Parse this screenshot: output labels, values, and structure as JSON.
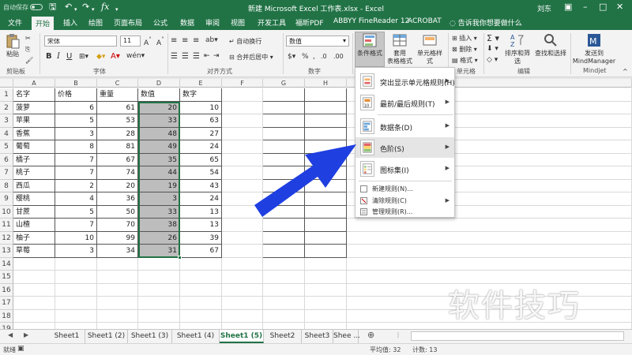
{
  "window": {
    "autosave": "自动保存",
    "title": "新建 Microsoft Excel 工作表.xlsx - Excel",
    "user": "刘东"
  },
  "tabs": [
    "文件",
    "开始",
    "插入",
    "绘图",
    "页面布局",
    "公式",
    "数据",
    "审阅",
    "视图",
    "开发工具",
    "福昕PDF",
    "ABBYY FineReader 12",
    "ACROBAT"
  ],
  "tell_me": "告诉我你想要做什么",
  "ribbon": {
    "paste": "粘贴",
    "font_name": "宋体",
    "font_size": "11",
    "wrap_text": "自动换行",
    "merge_center": "合并后居中",
    "number_format": "数值",
    "cond_format": "条件格式",
    "table_format": "套用\n表格格式",
    "cell_style": "单元格样式",
    "insert": "插入",
    "delete": "删除",
    "format": "格式",
    "sort_filter": "排序和筛选",
    "find_select": "查找和选择",
    "send_to": "发送到\nMindManager",
    "groups": {
      "clipboard": "剪贴板",
      "font": "字体",
      "alignment": "对齐方式",
      "number": "数字",
      "cells": "单元格",
      "editing": "编辑",
      "mindjet": "Mindjet"
    }
  },
  "columns": [
    "A",
    "B",
    "C",
    "D",
    "E",
    "F",
    "G",
    "H"
  ],
  "sheet": {
    "headers": [
      "名字",
      "价格",
      "重量",
      "数值",
      "数字"
    ],
    "rows": [
      [
        "菠萝",
        "6",
        "61",
        "20",
        "10"
      ],
      [
        "苹果",
        "5",
        "53",
        "33",
        "63"
      ],
      [
        "香蕉",
        "3",
        "28",
        "48",
        "27"
      ],
      [
        "葡萄",
        "8",
        "81",
        "49",
        "24"
      ],
      [
        "橘子",
        "7",
        "67",
        "35",
        "65"
      ],
      [
        "桃子",
        "7",
        "74",
        "44",
        "54"
      ],
      [
        "西瓜",
        "2",
        "20",
        "19",
        "43"
      ],
      [
        "樱桃",
        "4",
        "36",
        "3",
        "24"
      ],
      [
        "甘蔗",
        "5",
        "50",
        "33",
        "13"
      ],
      [
        "山楂",
        "7",
        "70",
        "38",
        "13"
      ],
      [
        "柚子",
        "10",
        "99",
        "26",
        "39"
      ],
      [
        "草莓",
        "3",
        "34",
        "31",
        "67"
      ]
    ],
    "row_numbers": [
      "1",
      "2",
      "3",
      "4",
      "5",
      "6",
      "7",
      "8",
      "9",
      "10",
      "11",
      "12",
      "13",
      "14",
      "15",
      "16",
      "17",
      "18",
      "19"
    ]
  },
  "cf_menu": {
    "items": [
      {
        "label": "突出显示单元格规则(H)",
        "has_sub": true
      },
      {
        "label": "最前/最后规则(T)",
        "has_sub": true
      },
      {
        "label": "数据条(D)",
        "has_sub": true
      },
      {
        "label": "色阶(S)",
        "has_sub": true
      },
      {
        "label": "图标集(I)",
        "has_sub": true
      }
    ],
    "small_items": [
      "新建规则(N)...",
      "清除规则(C)",
      "管理规则(R)..."
    ]
  },
  "sheet_tabs": [
    "Sheet1",
    "Sheet1 (2)",
    "Sheet1 (3)",
    "Sheet1 (4)",
    "Sheet1 (5)",
    "Sheet2",
    "Sheet3",
    "Shee ..."
  ],
  "active_sheet": "Sheet1 (5)",
  "status": {
    "mode": "就绪",
    "average": "平均值: 32",
    "count": "计数: 13"
  },
  "watermark": "软件技巧",
  "colors": {
    "excel_green": "#217346",
    "arrow_blue": "#1f3fe0",
    "selection_fill": "#bdbdbd"
  }
}
